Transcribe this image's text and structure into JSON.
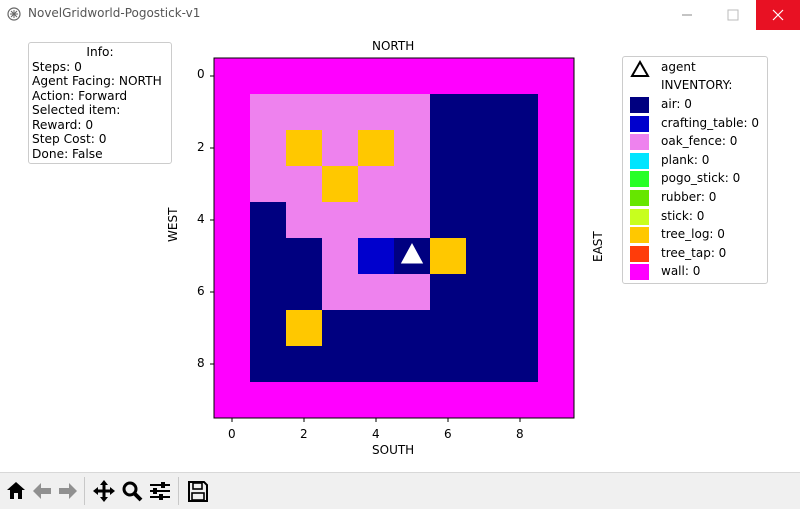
{
  "window": {
    "title": "NovelGridworld-Pogostick-v1",
    "icons": [
      "app-icon",
      "minimize-icon",
      "maximize-icon",
      "close-icon"
    ],
    "close_color": "#e81123"
  },
  "info": {
    "title": "Info:",
    "lines": [
      "Steps: 0",
      "Agent Facing: NORTH",
      "Action: Forward",
      "Selected item:",
      "Reward: 0",
      "Step Cost: 0",
      "Done: False"
    ]
  },
  "axes": {
    "top_label": "NORTH",
    "bottom_label": "SOUTH",
    "left_label": "WEST",
    "right_label": "EAST",
    "x_ticks": [
      "0",
      "2",
      "4",
      "6",
      "8"
    ],
    "y_ticks": [
      "0",
      "2",
      "4",
      "6",
      "8"
    ]
  },
  "legend": {
    "agent_label": "agent",
    "inventory_label": "INVENTORY:",
    "items": [
      {
        "label": "air: 0",
        "color": "#000080"
      },
      {
        "label": "crafting_table: 0",
        "color": "#0000cd"
      },
      {
        "label": "oak_fence: 0",
        "color": "#ee82ee"
      },
      {
        "label": "plank: 0",
        "color": "#00e5ff"
      },
      {
        "label": "pogo_stick: 0",
        "color": "#28ff28"
      },
      {
        "label": "rubber: 0",
        "color": "#66e600"
      },
      {
        "label": "stick: 0",
        "color": "#c8ff1e"
      },
      {
        "label": "tree_log: 0",
        "color": "#ffc800"
      },
      {
        "label": "tree_tap: 0",
        "color": "#ff3c0a"
      },
      {
        "label": "wall: 0",
        "color": "#ff00ff"
      }
    ]
  },
  "chart_data": {
    "type": "heatmap",
    "xlabel": "SOUTH",
    "ylabel": "WEST",
    "top_label": "NORTH",
    "right_label": "EAST",
    "xlim": [
      -0.5,
      9.5
    ],
    "ylim": [
      9.5,
      -0.5
    ],
    "x_ticks": [
      0,
      2,
      4,
      6,
      8
    ],
    "y_ticks": [
      0,
      2,
      4,
      6,
      8
    ],
    "legend": [
      "air",
      "crafting_table",
      "oak_fence",
      "plank",
      "pogo_stick",
      "rubber",
      "stick",
      "tree_log",
      "tree_tap",
      "wall"
    ],
    "colors": {
      "air": "#000080",
      "crafting_table": "#0000cd",
      "oak_fence": "#ee82ee",
      "tree_log": "#ffc800",
      "wall": "#ff00ff"
    },
    "grid": [
      [
        "wall",
        "wall",
        "wall",
        "wall",
        "wall",
        "wall",
        "wall",
        "wall",
        "wall",
        "wall"
      ],
      [
        "wall",
        "oak_fence",
        "oak_fence",
        "oak_fence",
        "oak_fence",
        "oak_fence",
        "air",
        "air",
        "air",
        "wall"
      ],
      [
        "wall",
        "oak_fence",
        "tree_log",
        "oak_fence",
        "tree_log",
        "oak_fence",
        "air",
        "air",
        "air",
        "wall"
      ],
      [
        "wall",
        "oak_fence",
        "oak_fence",
        "tree_log",
        "oak_fence",
        "oak_fence",
        "air",
        "air",
        "air",
        "wall"
      ],
      [
        "wall",
        "air",
        "oak_fence",
        "oak_fence",
        "oak_fence",
        "oak_fence",
        "air",
        "air",
        "air",
        "wall"
      ],
      [
        "wall",
        "air",
        "air",
        "oak_fence",
        "crafting_table",
        "air",
        "tree_log",
        "air",
        "air",
        "wall"
      ],
      [
        "wall",
        "air",
        "air",
        "oak_fence",
        "oak_fence",
        "oak_fence",
        "air",
        "air",
        "air",
        "wall"
      ],
      [
        "wall",
        "air",
        "tree_log",
        "air",
        "air",
        "air",
        "air",
        "air",
        "air",
        "wall"
      ],
      [
        "wall",
        "air",
        "air",
        "air",
        "air",
        "air",
        "air",
        "air",
        "air",
        "wall"
      ],
      [
        "wall",
        "wall",
        "wall",
        "wall",
        "wall",
        "wall",
        "wall",
        "wall",
        "wall",
        "wall"
      ]
    ],
    "agent": {
      "x": 5,
      "y": 5,
      "facing": "NORTH",
      "marker": "triangle-up"
    }
  },
  "toolbar": {
    "icons": [
      "home-icon",
      "back-arrow-icon",
      "forward-arrow-icon",
      "pan-icon",
      "zoom-icon",
      "configure-subplots-icon",
      "save-icon"
    ]
  }
}
